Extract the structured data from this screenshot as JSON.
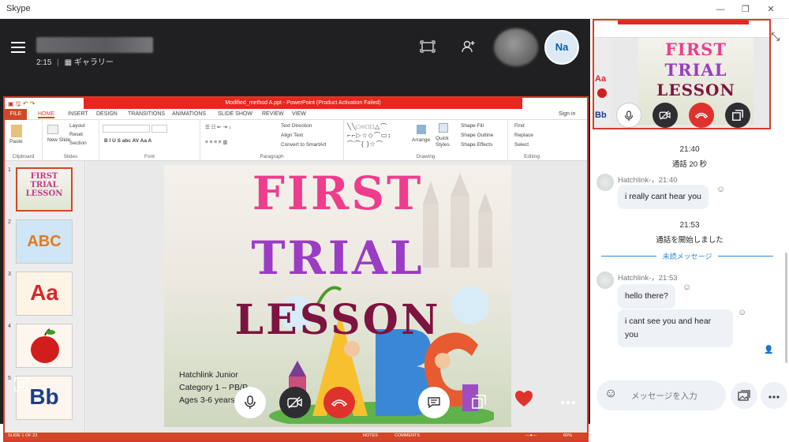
{
  "app_title": "Skype",
  "window_controls": {
    "minimize": "—",
    "maximize": "❐",
    "close": "✕"
  },
  "call": {
    "duration": "2:15",
    "view_mode": "ギャラリー",
    "participant_initials": "Na"
  },
  "powerpoint": {
    "window_title": "Modified_method A.ppt - PowerPoint (Product Activation Failed)",
    "sign_in": "Sign in",
    "tabs": [
      "FILE",
      "HOME",
      "INSERT",
      "DESIGN",
      "TRANSITIONS",
      "ANIMATIONS",
      "SLIDE SHOW",
      "REVIEW",
      "VIEW"
    ],
    "groups": {
      "clipboard": "Clipboard",
      "slides": "Slides",
      "font": "Font",
      "paragraph": "Paragraph",
      "drawing": "Drawing",
      "editing": "Editing"
    },
    "ribbon_items": {
      "paste": "Paste",
      "new_slide": "New Slide",
      "layout": "Layout",
      "reset": "Reset",
      "section": "Section",
      "text_direction": "Text Direction",
      "align_text": "Align Text",
      "convert_smartart": "Convert to SmartArt",
      "arrange": "Arrange",
      "quick_styles": "Quick Styles",
      "shape_fill": "Shape Fill",
      "shape_outline": "Shape Outline",
      "shape_effects": "Shape Effects",
      "find": "Find",
      "replace": "Replace",
      "select": "Select"
    },
    "thumbnails": [
      {
        "num": "1",
        "text": "FIRST TRIAL LESSON"
      },
      {
        "num": "2",
        "text": "ABC"
      },
      {
        "num": "3",
        "text": "Aa"
      },
      {
        "num": "4",
        "text": ""
      },
      {
        "num": "5",
        "text": "Bb"
      }
    ],
    "slide": {
      "line1": "FIRST",
      "line2": "TRIAL",
      "line3": "LESSON",
      "info1": "Hatchlink Junior",
      "info2": "Category 1 – PB/P",
      "info3": "Ages 3-6 years"
    },
    "status": {
      "slide_of": "SLIDE 1 OF 23",
      "notes": "NOTES",
      "comments": "COMMENTS",
      "zoom": "60%"
    }
  },
  "pip": {
    "line1": "FIRST",
    "line2": "TRIAL",
    "line3": "LESSON",
    "thumb_aa": "Aa",
    "thumb_bb": "Bb"
  },
  "chat": {
    "time1": "21:40",
    "call_duration": "通話 20 秒",
    "msg1_sender": "Hatchlink-，21:40",
    "msg1_text": "i really cant hear you",
    "time2": "21:53",
    "call_started": "通話を開始しました",
    "unread_label": "未読メッセージ",
    "msg2_sender": "Hatchlink-，21:53",
    "msg2_text": "hello there?",
    "msg3_text": "i cant see you and hear you",
    "composer_placeholder": "メッセージを入力"
  },
  "colors": {
    "title_pink": "#ee3d8d",
    "title_purple": "#9b3cc4",
    "title_maroon": "#7c1440",
    "ppt_red": "#d24726",
    "skype_blue": "#2a8ad6",
    "end_call_red": "#e0322d"
  },
  "icons": {
    "hamburger": "menu-icon",
    "gallery": "gallery-icon",
    "screen": "screen-share-icon",
    "add_person": "add-participant-icon",
    "mic": "microphone-icon",
    "video_off": "video-off-icon",
    "end_call": "end-call-icon",
    "chat": "chat-icon",
    "popout": "popout-icon",
    "heart": "heart-icon",
    "more": "more-icon"
  }
}
